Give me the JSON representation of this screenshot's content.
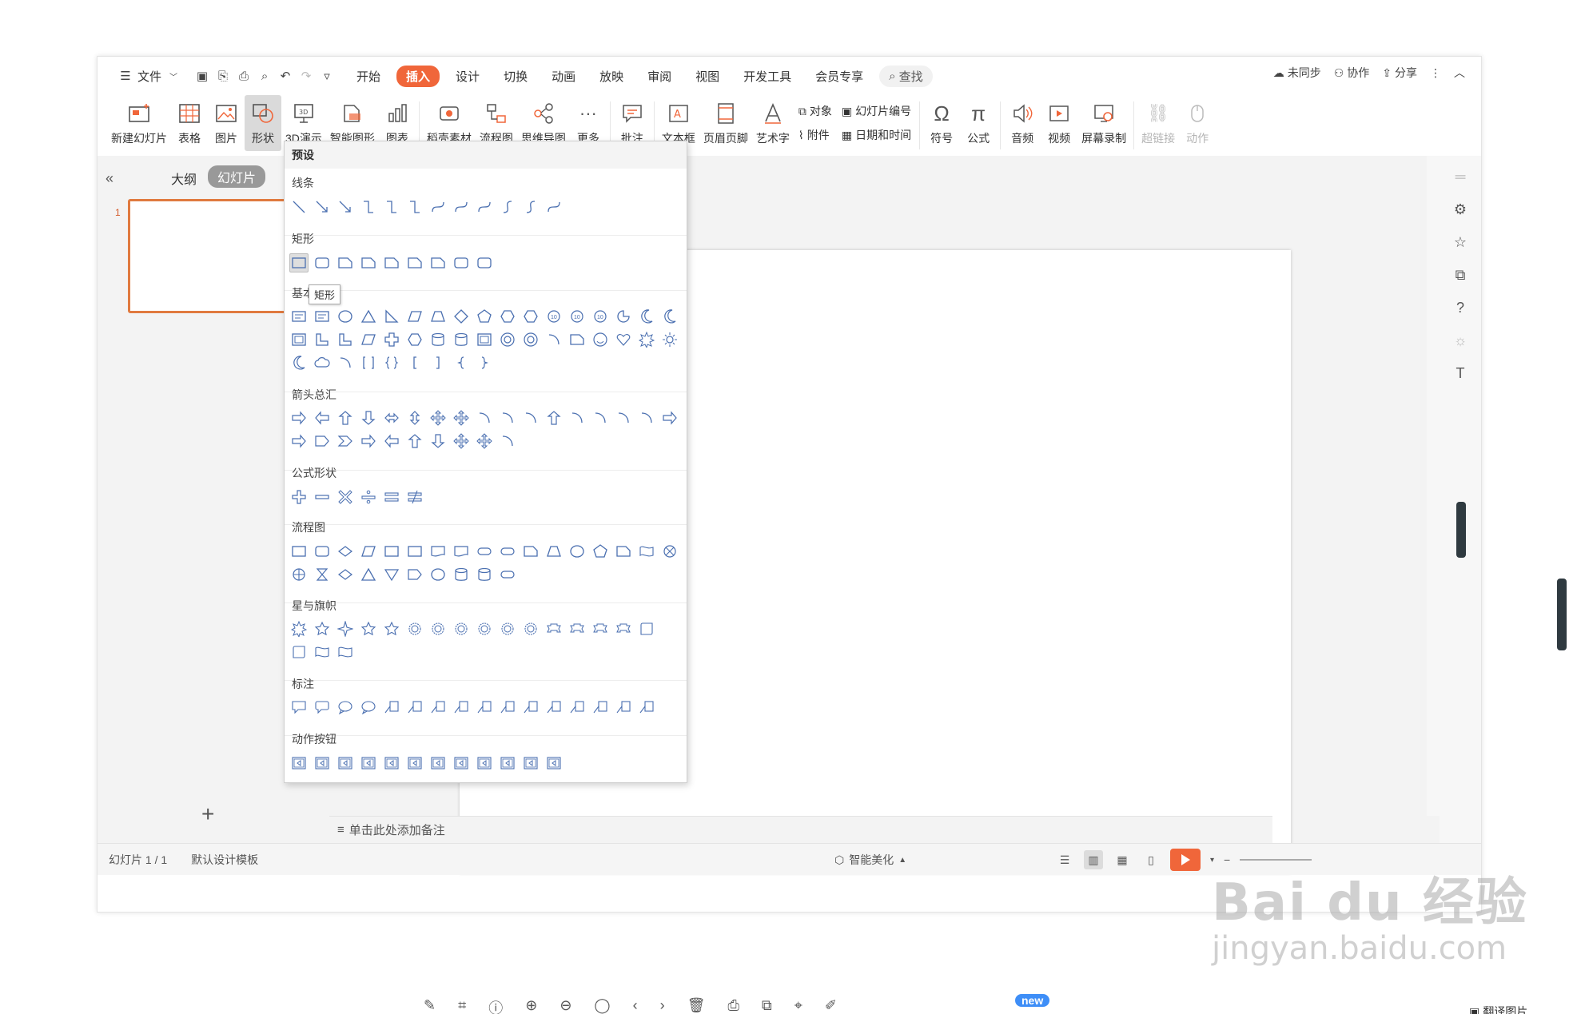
{
  "menubar": {
    "file": "文件",
    "tabs": [
      "开始",
      "插入",
      "设计",
      "切换",
      "动画",
      "放映",
      "审阅",
      "视图",
      "开发工具",
      "会员专享"
    ],
    "active_tab": "插入",
    "search": "查找",
    "right": {
      "sync": "未同步",
      "collab": "协作",
      "share": "分享"
    }
  },
  "ribbon": {
    "new_slide": "新建幻灯片",
    "table": "表格",
    "picture": "图片",
    "shape": "形状",
    "demo3d": "3D演示",
    "smart_graphic": "智能图形",
    "chart": "图表",
    "material": "稻壳素材",
    "flowchart": "流程图",
    "mindmap": "思维导图",
    "more": "更多",
    "comment": "批注",
    "textbox": "文本框",
    "header_footer": "页眉页脚",
    "art_text": "艺术字",
    "object": "对象",
    "attachment": "附件",
    "slide_number": "幻灯片编号",
    "datetime": "日期和时间",
    "symbol": "符号",
    "formula": "公式",
    "audio": "音频",
    "video": "视频",
    "screen_record": "屏幕录制",
    "hyperlink": "超链接",
    "action": "动作"
  },
  "left_panel": {
    "outline_tab": "大纲",
    "slides_tab": "幻灯片",
    "slide_number": "1"
  },
  "notes": {
    "placeholder": "单击此处添加备注"
  },
  "statusbar": {
    "slide_info": "幻灯片 1 / 1",
    "template": "默认设计模板",
    "beautify": "智能美化"
  },
  "dropdown": {
    "header": "预设",
    "sections": {
      "lines": "线条",
      "rect": "矩形",
      "basic": "基本",
      "arrows": "箭头总汇",
      "formula": "公式形状",
      "flow": "流程图",
      "stars": "星与旗帜",
      "callouts": "标注",
      "action_buttons": "动作按钮"
    },
    "tooltip": "矩形"
  },
  "bottom": {
    "new_badge": "new",
    "translate": "翻译图片"
  },
  "watermark": {
    "main": "Bai du 经验",
    "sub": "jingyan.baidu.com"
  },
  "colors": {
    "accent": "#f0663a",
    "shape_stroke": "#4a6fb0",
    "thumb_border": "#e07a3f"
  }
}
